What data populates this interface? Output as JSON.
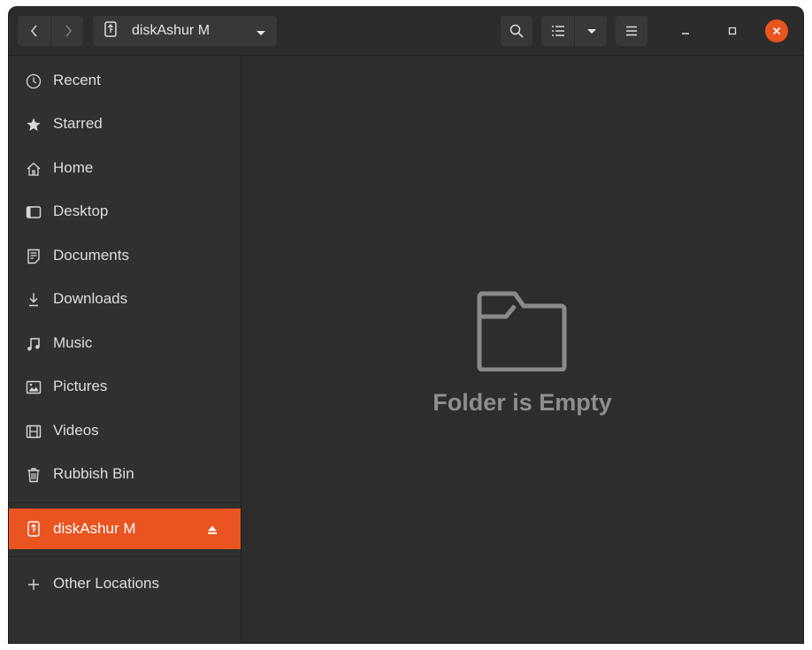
{
  "window": {
    "path_label": "diskAshur M"
  },
  "sidebar": {
    "items": [
      {
        "label": "Recent",
        "icon": "clock-icon"
      },
      {
        "label": "Starred",
        "icon": "star-icon"
      },
      {
        "label": "Home",
        "icon": "home-icon"
      },
      {
        "label": "Desktop",
        "icon": "desktop-icon"
      },
      {
        "label": "Documents",
        "icon": "document-icon"
      },
      {
        "label": "Downloads",
        "icon": "download-icon"
      },
      {
        "label": "Music",
        "icon": "music-icon"
      },
      {
        "label": "Pictures",
        "icon": "picture-icon"
      },
      {
        "label": "Videos",
        "icon": "video-icon"
      },
      {
        "label": "Rubbish Bin",
        "icon": "trash-icon"
      }
    ],
    "device": {
      "label": "diskAshur M",
      "icon": "usb-drive-icon",
      "eject_icon": "eject-icon",
      "active": true
    },
    "other": {
      "label": "Other Locations",
      "icon": "plus-icon"
    }
  },
  "content": {
    "empty_message": "Folder is Empty",
    "empty_icon": "folder-icon"
  },
  "colors": {
    "accent": "#e95420",
    "background": "#2d2d2d",
    "sidebar": "#303030"
  }
}
